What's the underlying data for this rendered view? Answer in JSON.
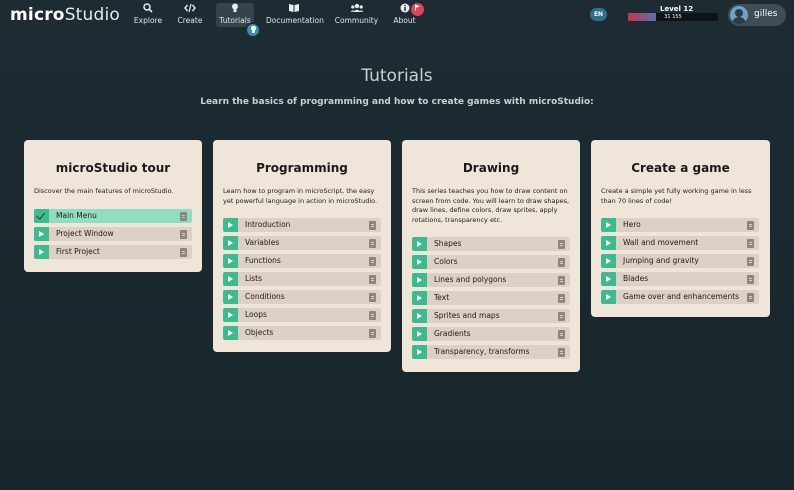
{
  "app": {
    "logo_bold": "micro",
    "logo_rest": "Studio"
  },
  "nav": [
    {
      "label": "Explore",
      "icon": "search-icon"
    },
    {
      "label": "Create",
      "icon": "code-icon"
    },
    {
      "label": "Tutorials",
      "icon": "lightbulb-icon"
    },
    {
      "label": "Documentation",
      "icon": "book-icon"
    },
    {
      "label": "Community",
      "icon": "users-icon"
    },
    {
      "label": "About",
      "icon": "info-icon"
    }
  ],
  "header": {
    "language": "EN",
    "level": "Level 12",
    "xp": "31 155",
    "xp_progress": 0.31,
    "username": "gilles"
  },
  "page": {
    "title": "Tutorials",
    "subtitle": "Learn the basics of programming and how to create games with microStudio:"
  },
  "cards": [
    {
      "title": "microStudio tour",
      "description": "Discover the main features of microStudio.",
      "items": [
        "Main Menu",
        "Project Window",
        "First Project"
      ]
    },
    {
      "title": "Programming",
      "description": "Learn how to program in microScript, the easy yet powerful language in action in microStudio.",
      "items": [
        "Introduction",
        "Variables",
        "Functions",
        "Lists",
        "Conditions",
        "Loops",
        "Objects"
      ]
    },
    {
      "title": "Drawing",
      "description": "This series teaches you how to draw content on screen from code. You will learn to draw shapes, draw lines, define colors, draw sprites, apply rotations, transparency etc.",
      "items": [
        "Shapes",
        "Colors",
        "Lines and polygons",
        "Text",
        "Sprites and maps",
        "Gradients",
        "Transparency, transforms"
      ]
    },
    {
      "title": "Create a game",
      "description": "Create a simple yet fully working game in less than 70 lines of code!",
      "items": [
        "Hero",
        "Wall and movement",
        "Jumping and gravity",
        "Blades",
        "Game over and enhancements"
      ]
    }
  ],
  "colors": {
    "accent": "#3dbb8f",
    "completed": "#90ddc1",
    "card": "#efe5d9",
    "background": "#1e2b33"
  }
}
